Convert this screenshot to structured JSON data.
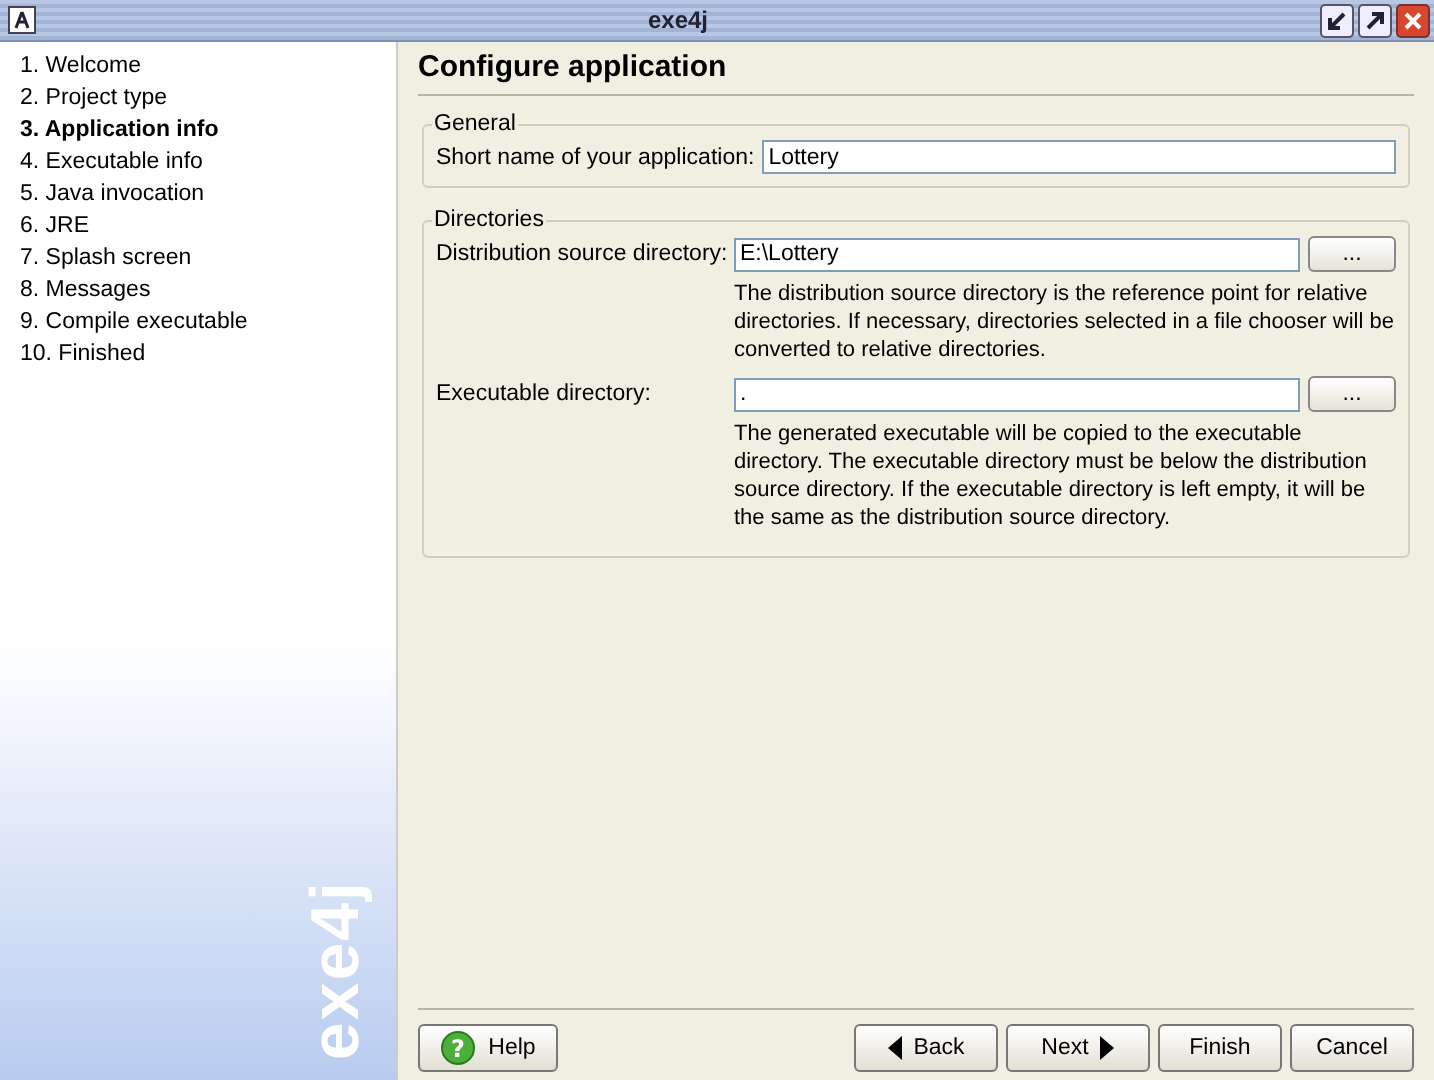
{
  "window": {
    "title": "exe4j"
  },
  "sidebar": {
    "items": [
      {
        "label": "1. Welcome",
        "selected": false
      },
      {
        "label": "2. Project type",
        "selected": false
      },
      {
        "label": "3. Application info",
        "selected": true
      },
      {
        "label": "4. Executable info",
        "selected": false
      },
      {
        "label": "5. Java invocation",
        "selected": false
      },
      {
        "label": "6. JRE",
        "selected": false
      },
      {
        "label": "7. Splash screen",
        "selected": false
      },
      {
        "label": "8. Messages",
        "selected": false
      },
      {
        "label": "9. Compile executable",
        "selected": false
      },
      {
        "label": "10. Finished",
        "selected": false
      }
    ],
    "logo": "exe4j"
  },
  "page": {
    "title": "Configure application",
    "groups": [
      {
        "title": "General",
        "rows": [
          {
            "label": "Short name of your application:",
            "value": "Lottery"
          }
        ]
      },
      {
        "title": "Directories",
        "rows": [
          {
            "label": "Distribution source directory:",
            "value": "E:\\Lottery",
            "browse": "...",
            "help": "The distribution source directory is the reference point for relative directories. If necessary, directories selected in a file chooser will be converted to relative directories."
          },
          {
            "label": "Executable directory:",
            "value": ".",
            "browse": "...",
            "help": "The generated executable will be copied to the executable directory. The executable directory must be below the distribution source directory. If the executable directory is left empty, it will be the same as the distribution source directory."
          }
        ]
      }
    ]
  },
  "buttons": {
    "help_icon": "?",
    "help": "Help",
    "back": "Back",
    "next": "Next",
    "finish": "Finish",
    "cancel": "Cancel"
  }
}
